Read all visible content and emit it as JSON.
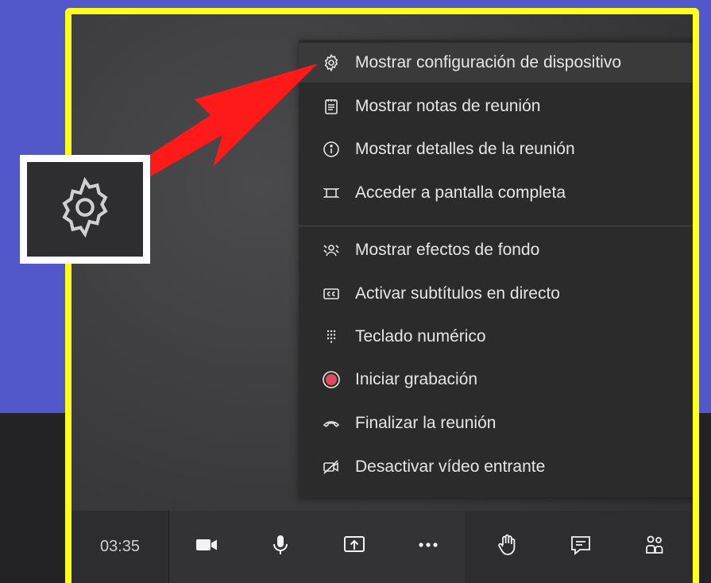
{
  "menu": {
    "items": [
      {
        "label": "Mostrar configuración de dispositivo",
        "icon": "gear-icon"
      },
      {
        "label": "Mostrar notas de reunión",
        "icon": "notes-icon"
      },
      {
        "label": "Mostrar detalles de la reunión",
        "icon": "info-icon"
      },
      {
        "label": "Acceder a pantalla completa",
        "icon": "fullscreen-icon"
      },
      {
        "label": "Mostrar efectos de fondo",
        "icon": "background-effects-icon"
      },
      {
        "label": "Activar subtítulos en directo",
        "icon": "captions-icon"
      },
      {
        "label": "Teclado numérico",
        "icon": "dialpad-icon"
      },
      {
        "label": "Iniciar grabación",
        "icon": "record-icon"
      },
      {
        "label": "Finalizar la reunión",
        "icon": "hangup-icon"
      },
      {
        "label": "Desactivar vídeo entrante",
        "icon": "video-off-icon"
      }
    ]
  },
  "toolbar": {
    "time": "03:35",
    "buttons": [
      "camera-icon",
      "microphone-icon",
      "share-screen-icon",
      "more-options-icon",
      "raise-hand-icon",
      "chat-icon",
      "participants-icon"
    ]
  },
  "colors": {
    "highlight_border": "#ffff1a",
    "background": "#5257c9",
    "arrow": "#ff1a1a",
    "record": "#e04a5f"
  }
}
